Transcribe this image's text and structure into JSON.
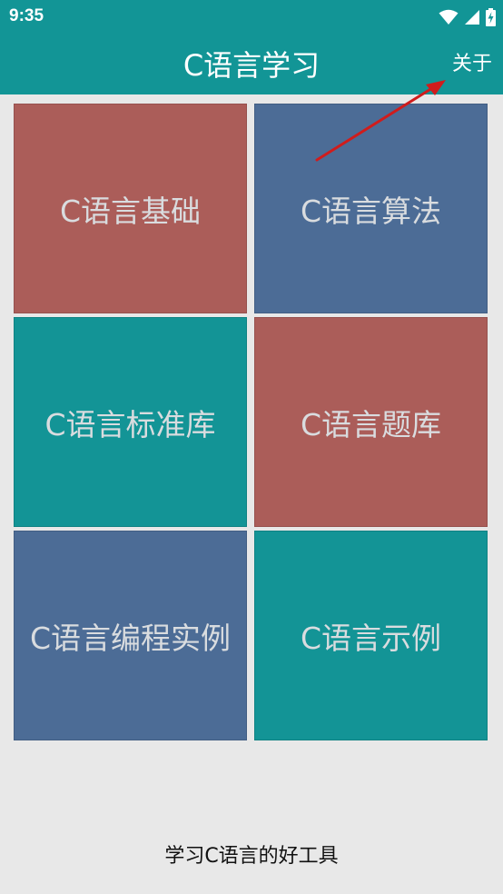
{
  "status_bar": {
    "time": "9:35",
    "icons": [
      "wifi-icon",
      "cell-signal-icon",
      "battery-icon"
    ]
  },
  "app_bar": {
    "title": "C语言学习",
    "about_label": "关于"
  },
  "tiles": [
    {
      "label": "C语言基础",
      "color": "#ab5d59"
    },
    {
      "label": "C语言算法",
      "color": "#4c6c96"
    },
    {
      "label": "C语言标准库",
      "color": "#139496"
    },
    {
      "label": "C语言题库",
      "color": "#ab5d59"
    },
    {
      "label": "C语言编程实例",
      "color": "#4c6c96"
    },
    {
      "label": "C语言示例",
      "color": "#139496"
    }
  ],
  "footer": {
    "text": "学习C语言的好工具"
  },
  "colors": {
    "primary": "#129596",
    "background": "#e8e8e8",
    "tile_text": "#d9dcdf",
    "annotation_arrow": "#d01c1c"
  }
}
